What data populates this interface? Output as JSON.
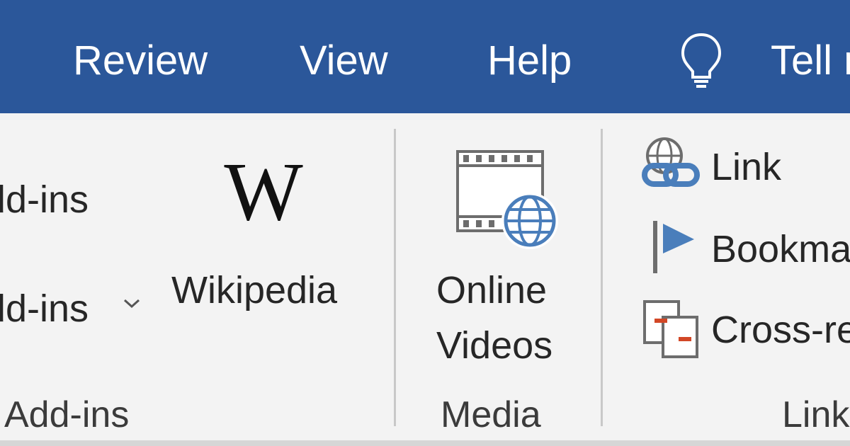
{
  "tabs": {
    "review": "Review",
    "view": "View",
    "help": "Help",
    "tell_me": "Tell me"
  },
  "icons": {
    "lightbulb": "lightbulb-icon",
    "wikipedia": "wikipedia-icon",
    "online_videos": "online-video-icon",
    "link": "link-icon",
    "bookmark": "bookmark-icon",
    "cross_reference": "cross-reference-icon"
  },
  "addins_group": {
    "get_addins": "Get Add-ins",
    "my_addins": "My Add-ins",
    "label": "Add-ins"
  },
  "wikipedia": {
    "label": "Wikipedia"
  },
  "media_group": {
    "online_videos_line1": "Online",
    "online_videos_line2": "Videos",
    "label": "Media"
  },
  "links_group": {
    "link": "Link",
    "bookmark": "Bookmark",
    "cross_reference": "Cross-reference",
    "label": "Links"
  },
  "colors": {
    "ribbon_blue": "#2b579a",
    "ribbon_bg": "#f3f3f3",
    "icon_blue": "#4a7ebb",
    "icon_red": "#d24726"
  }
}
